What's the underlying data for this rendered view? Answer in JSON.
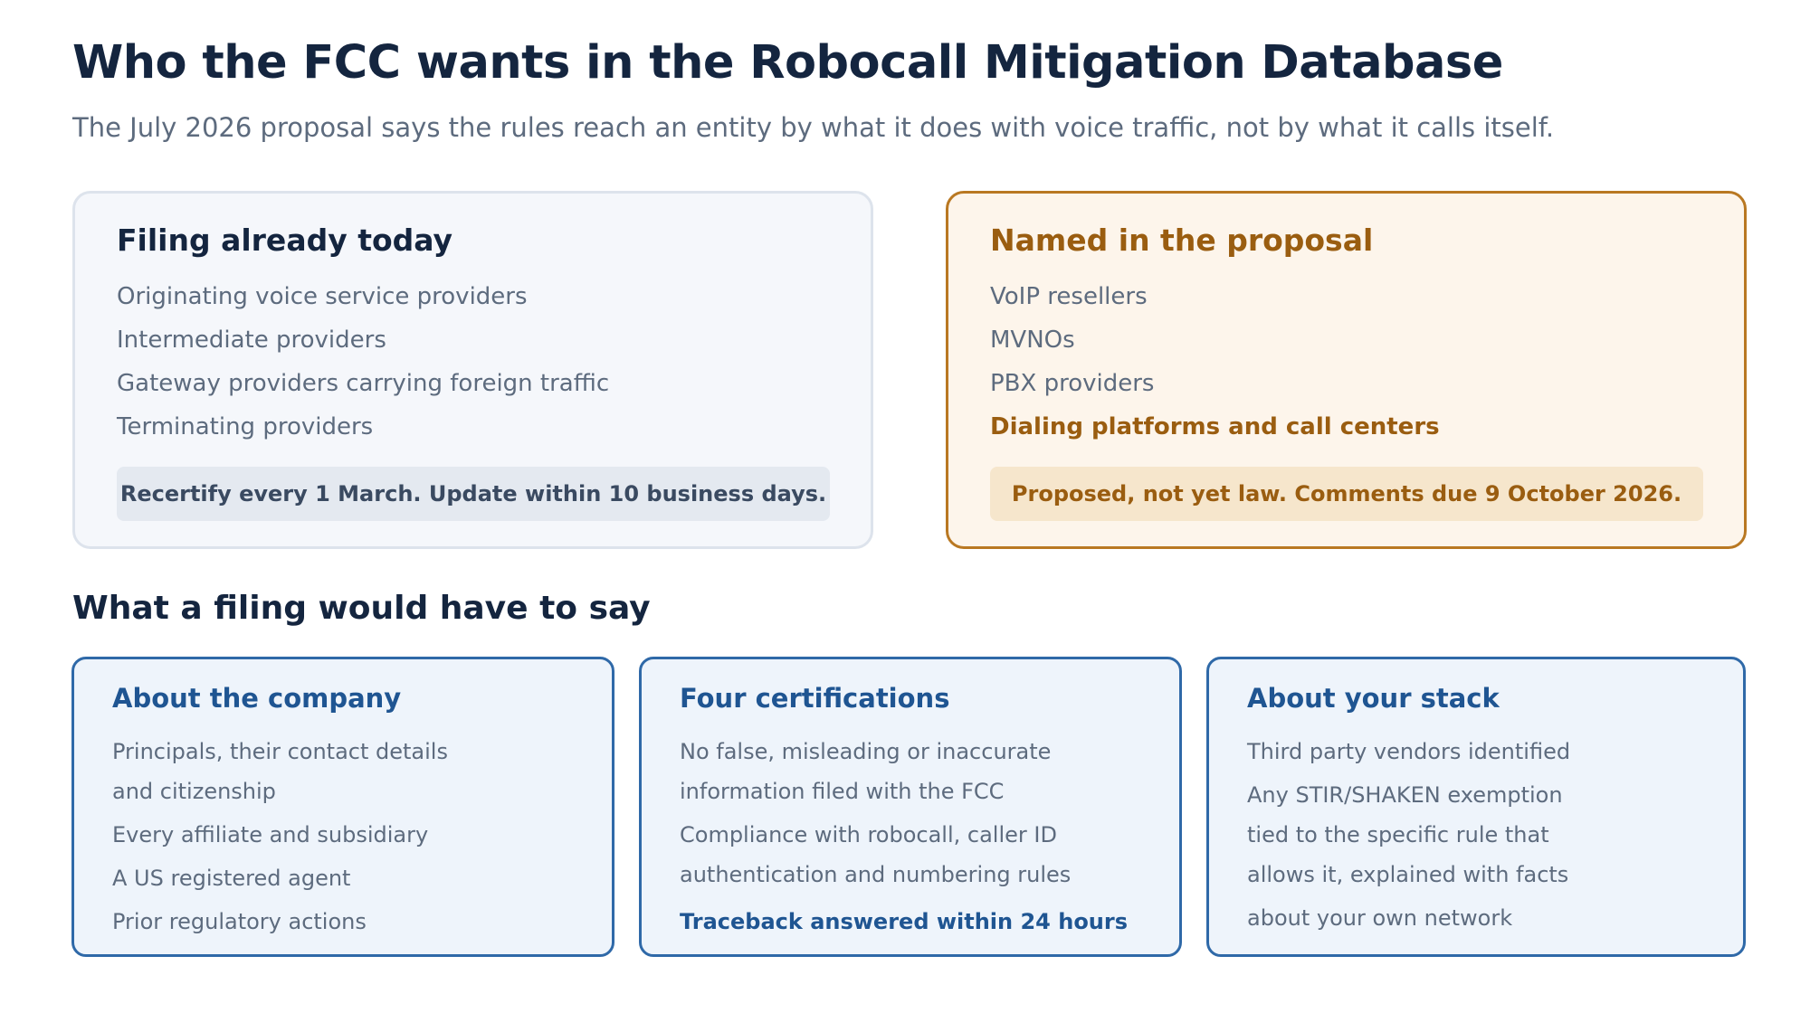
{
  "title": "Who the FCC wants in the Robocall Mitigation Database",
  "subtitle": "The July 2026 proposal says the rules reach an entity by what it does with voice traffic, not by what it calls itself.",
  "panels": {
    "today": {
      "heading": "Filing already today",
      "items": [
        "Originating voice service providers",
        "Intermediate providers",
        "Gateway providers carrying foreign traffic",
        "Terminating providers"
      ],
      "note": "Recertify every 1 March. Update within 10 business days."
    },
    "proposal": {
      "heading": "Named in the proposal",
      "items": [
        "VoIP resellers",
        "MVNOs",
        "PBX providers",
        "Dialing platforms and call centers"
      ],
      "note": "Proposed, not yet law. Comments due 9 October 2026."
    }
  },
  "section_title": "What a filing would have to say",
  "cards": [
    {
      "heading": "About the company",
      "lines": [
        "Principals, their contact details",
        "and citizenship",
        "Every affiliate and subsidiary",
        "A US registered agent",
        "Prior regulatory actions"
      ]
    },
    {
      "heading": "Four certifications",
      "lines": [
        "No false, misleading or inaccurate",
        "information filed with the FCC",
        "Compliance with robocall, caller ID",
        "authentication and numbering rules",
        "Traceback answered within 24 hours"
      ]
    },
    {
      "heading": "About your stack",
      "lines": [
        "Third party vendors identified",
        "Any STIR/SHAKEN exemption",
        "tied to the specific rule that",
        "allows it, explained with facts",
        "about your own network"
      ]
    }
  ],
  "colors": {
    "navy": "#14253f",
    "amber": "#b97822",
    "blue": "#2f69a8"
  }
}
